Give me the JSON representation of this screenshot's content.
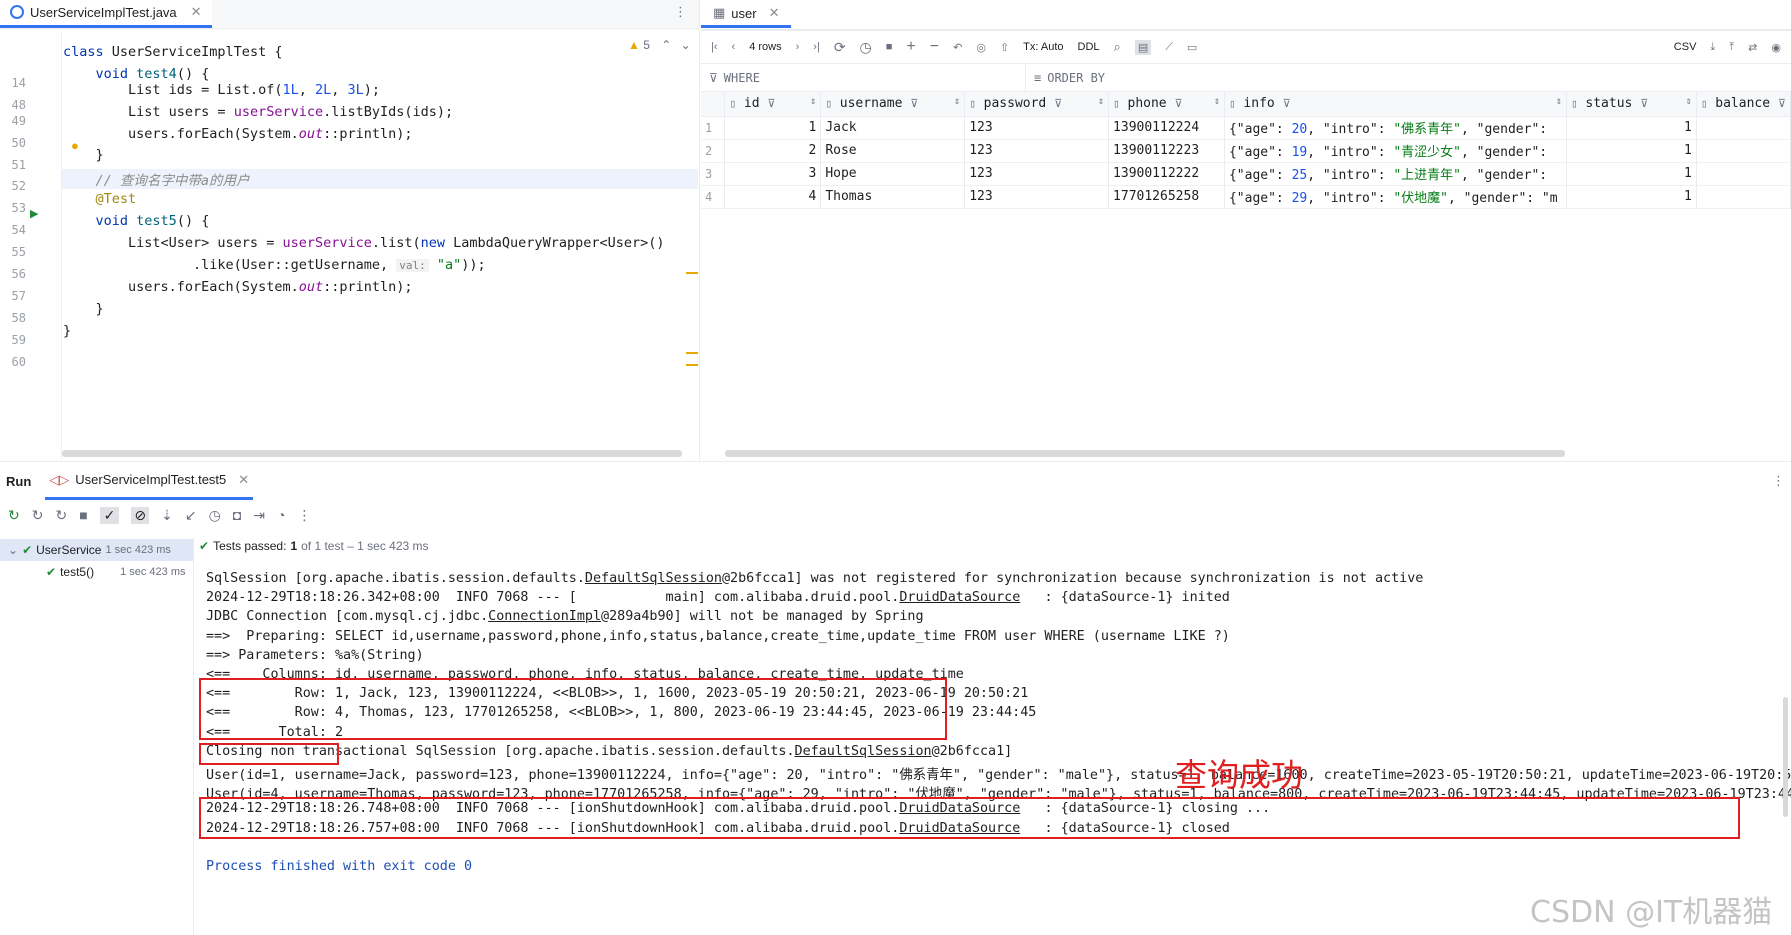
{
  "editor": {
    "tab_label": "UserServiceImplTest.java",
    "warnings": "5",
    "lines": [
      {
        "n": "14",
        "text": "class UserServiceImplTest {"
      },
      {
        "n": "48",
        "text": "    void test4() {"
      },
      {
        "n": "49",
        "text": "        List ids = List.of(1L, 2L, 3L);"
      },
      {
        "n": "50",
        "text": "        List users = userService.listByIds(ids);"
      },
      {
        "n": "51",
        "text": "        users.forEach(System.out::println);"
      },
      {
        "n": "52",
        "text": "    }"
      },
      {
        "n": "53",
        "text": "    // 查询名字中带a的用户"
      },
      {
        "n": "54",
        "text": "    @Test"
      },
      {
        "n": "55",
        "text": "    void test5() {"
      },
      {
        "n": "56",
        "text": "        List<User> users = userService.list(new LambdaQueryWrapper<User>()"
      },
      {
        "n": "57",
        "text": "                .like(User::getUsername,  \"a\"));"
      },
      {
        "n": "57h",
        "text": "val:"
      },
      {
        "n": "58",
        "text": "        users.forEach(System.out::println);"
      },
      {
        "n": "59",
        "text": "    }"
      },
      {
        "n": "60",
        "text": "}"
      }
    ]
  },
  "db": {
    "tab_label": "user",
    "rows_label": "4 rows",
    "tx_label": "Tx: Auto",
    "ddl_label": "DDL",
    "csv_label": "CSV",
    "where_label": "WHERE",
    "orderby_label": "ORDER BY",
    "columns": [
      "id",
      "username",
      "password",
      "phone",
      "info",
      "status",
      "balance"
    ],
    "rows": [
      {
        "rn": "1",
        "id": "1",
        "username": "Jack",
        "password": "123",
        "phone": "13900112224",
        "info_pre": "{\"age\": ",
        "info_num": "20",
        "info_mid": ", \"intro\": ",
        "info_str": "\"佛系青年\"",
        "info_post": ", \"gender\":",
        "status": "1"
      },
      {
        "rn": "2",
        "id": "2",
        "username": "Rose",
        "password": "123",
        "phone": "13900112223",
        "info_pre": "{\"age\": ",
        "info_num": "19",
        "info_mid": ", \"intro\": ",
        "info_str": "\"青涩少女\"",
        "info_post": ", \"gender\":",
        "status": "1"
      },
      {
        "rn": "3",
        "id": "3",
        "username": "Hope",
        "password": "123",
        "phone": "13900112222",
        "info_pre": "{\"age\": ",
        "info_num": "25",
        "info_mid": ", \"intro\": ",
        "info_str": "\"上进青年\"",
        "info_post": ", \"gender\":",
        "status": "1"
      },
      {
        "rn": "4",
        "id": "4",
        "username": "Thomas",
        "password": "123",
        "phone": "17701265258",
        "info_pre": "{\"age\": ",
        "info_num": "29",
        "info_mid": ", \"intro\": ",
        "info_str": "\"伏地魔\"",
        "info_post": ", \"gender\": \"m",
        "status": "1"
      }
    ]
  },
  "run": {
    "title": "Run",
    "tab_label": "UserServiceImplTest.test5",
    "tree_root": "UserService",
    "tree_root_time": "1 sec 423 ms",
    "tree_child": "test5()",
    "tree_child_time": "1 sec 423 ms",
    "tests_passed": "Tests passed:",
    "tests_count": "1",
    "tests_rest": "of 1 test – 1 sec 423 ms",
    "annotation": "查询成功",
    "console": [
      "SqlSession [org.apache.ibatis.session.defaults.DefaultSqlSession@2b6fcca1] was not registered for synchronization because synchronization is not active",
      "2024-12-29T18:18:26.342+08:00  INFO 7068 --- [           main] com.alibaba.druid.pool.DruidDataSource   : {dataSource-1} inited",
      "JDBC Connection [com.mysql.cj.jdbc.ConnectionImpl@289a4b90] will not be managed by Spring",
      "==>  Preparing: SELECT id,username,password,phone,info,status,balance,create_time,update_time FROM user WHERE (username LIKE ?)",
      "==> Parameters: %a%(String)",
      "<==    Columns: id, username, password, phone, info, status, balance, create_time, update_time",
      "<==        Row: 1, Jack, 123, 13900112224, <<BLOB>>, 1, 1600, 2023-05-19 20:50:21, 2023-06-19 20:50:21",
      "<==        Row: 4, Thomas, 123, 17701265258, <<BLOB>>, 1, 800, 2023-06-19 23:44:45, 2023-06-19 23:44:45",
      "<==      Total: 2",
      "Closing non transactional SqlSession [org.apache.ibatis.session.defaults.DefaultSqlSession@2b6fcca1]",
      "User(id=1, username=Jack, password=123, phone=13900112224, info={\"age\": 20, \"intro\": \"佛系青年\", \"gender\": \"male\"}, status=1, balance=1600, createTime=2023-05-19T20:50:21, updateTime=2023-06-19T20:50:",
      "User(id=4, username=Thomas, password=123, phone=17701265258, info={\"age\": 29, \"intro\": \"伏地魔\", \"gender\": \"male\"}, status=1, balance=800, createTime=2023-06-19T23:44:45, updateTime=2023-06-19T23:44:",
      "2024-12-29T18:18:26.748+08:00  INFO 7068 --- [ionShutdownHook] com.alibaba.druid.pool.DruidDataSource   : {dataSource-1} closing ...",
      "2024-12-29T18:18:26.757+08:00  INFO 7068 --- [ionShutdownHook] com.alibaba.druid.pool.DruidDataSource   : {dataSource-1} closed",
      "",
      "Process finished with exit code 0"
    ],
    "watermark": "CSDN @IT机器猫"
  }
}
